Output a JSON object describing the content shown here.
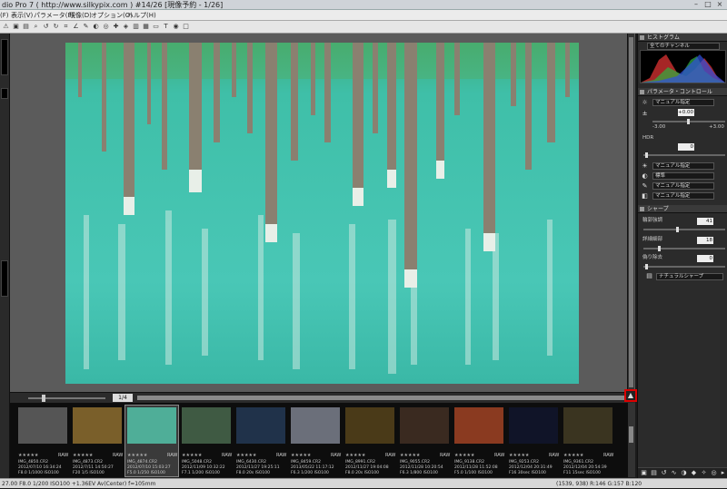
{
  "window": {
    "title": "dio Pro 7 ( http://www.silkypix.com )   #14/26 [現像予約 - 1/26]",
    "controls": [
      "–",
      "□",
      "×"
    ]
  },
  "menu": {
    "items": [
      "(F)",
      "表示(V)",
      "パラメータ(P)",
      "現像(D)",
      "オプション(O)",
      "ヘルプ(H)"
    ]
  },
  "viewer": {
    "zoom_value": "1/4",
    "highlight_button_icon": "highlight-warning-icon"
  },
  "filmstrip": {
    "items": [
      {
        "file": "IMG_4850.CR2",
        "date": "2012/07/10 16:34:24",
        "exif": "F8.0 1/1000 ISO100",
        "rating": "★★★★★",
        "raw": "RAW",
        "color": "#555"
      },
      {
        "file": "IMG_4873.CR2",
        "date": "2012/7/11 14:50:27",
        "exif": "F20 1/5 ISO100",
        "rating": "★★★★★",
        "raw": "RAW",
        "color": "#7a5f2a"
      },
      {
        "file": "IMG_4874.CR2",
        "date": "2012/07/10 15:03:27",
        "exif": "F5.0 1/250 ISO100",
        "rating": "★★★★★",
        "raw": "RAW",
        "color": "#4fae98"
      },
      {
        "file": "IMG_5048.CR2",
        "date": "2012/11/09 10:32:22",
        "exif": "F7.1 1/200 ISO100",
        "rating": "★★★★★",
        "raw": "RAW",
        "color": "#3f5a43"
      },
      {
        "file": "IMG_6430.CR2",
        "date": "2012/11/27 19:25:11",
        "exif": "F8.0 20s ISO100",
        "rating": "★★★★★",
        "raw": "RAW",
        "color": "#20324a"
      },
      {
        "file": "IMG_8459.CR2",
        "date": "2013/05/22 11:17:12",
        "exif": "F6.3 1/200 ISO100",
        "rating": "★★★★★",
        "raw": "RAW",
        "color": "#6b6f7a"
      },
      {
        "file": "IMG_8991.CR2",
        "date": "2012/11/27 19:04:08",
        "exif": "F8.0 20s ISO100",
        "rating": "★★★★★",
        "raw": "RAW",
        "color": "#4a3a18"
      },
      {
        "file": "IMG_9055.CR2",
        "date": "2012/11/28 10:20:54",
        "exif": "F6.3 1/800 ISO100",
        "rating": "★★★★★",
        "raw": "RAW",
        "color": "#3a2a20"
      },
      {
        "file": "IMG_9138.CR2",
        "date": "2012/11/28 11:52:08",
        "exif": "F5.0 1/100 ISO100",
        "rating": "★★★★★",
        "raw": "RAW",
        "color": "#8a3a20"
      },
      {
        "file": "IMG_9253.CR2",
        "date": "2012/12/04 20:31:49",
        "exif": "F16 30sec ISO100",
        "rating": "★★★★★",
        "raw": "RAW",
        "color": "#101428"
      },
      {
        "file": "IMG_9361.CR2",
        "date": "2012/12/04 20:54:39",
        "exif": "F11 15sec ISO100",
        "rating": "★★★★★",
        "raw": "RAW",
        "color": "#3a3420"
      }
    ]
  },
  "status": {
    "left": "27.00 F8.0 1/200 ISO100 +1.36EV Av(Center) f=105mm",
    "right": "(1539, 938) R:146 G:157 B:120"
  },
  "panel": {
    "histogram_label": "ヒストグラム",
    "histogram_channel": "全てのチャンネル",
    "param_label": "パラメータ・コントロール",
    "wb_mode": "マニュアル指定",
    "exposure_value": "+0.00",
    "scale_min": "-3.00",
    "scale_max": "+3.00",
    "hdr_label": "HDR",
    "hdr_value": "0",
    "tone_mode": "マニュアル指定",
    "color_mode": "標準",
    "saturation_mode": "マニュアル指定",
    "edge_mode": "マニュアル指定",
    "sharp_label": "シャープ",
    "sharp_strength_label": "輪郭強調",
    "sharp_strength_value": "41",
    "sharp_detail_label": "詳細細部",
    "sharp_detail_value": "18",
    "sharp_noise_label": "偽り除去",
    "sharp_noise_value": "0",
    "sharp_preset": "ナチュラルシャープ"
  },
  "colors": {
    "water": "#3fbfa8",
    "selection": "#888888",
    "highlight_border": "#dd0000"
  }
}
